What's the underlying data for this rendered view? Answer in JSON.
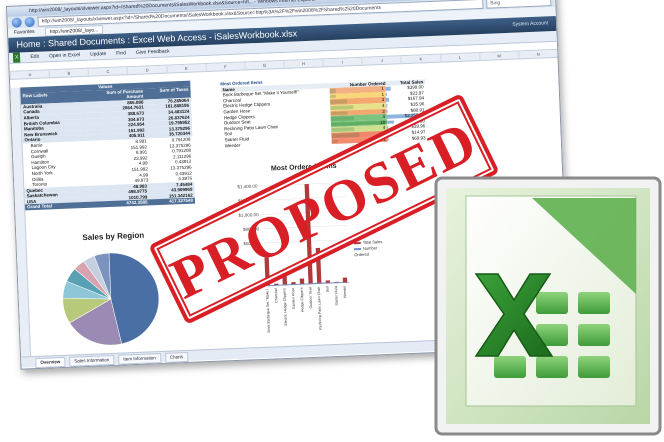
{
  "window": {
    "title": "http://win2008/_layouts/xlviewer.aspx?id=/Shared%20Documents/iSalesWorkbook.xlsx&Source=htt... - Windows Internet Explorer",
    "address": "http://win2008/_layouts/xlviewer.aspx?id=/Shared%20Documents/iSalesWorkbook.xlsx&Source=http%3A%2F%2Fwin2008%2FShared%2520Documents",
    "search_placeholder": "Bing",
    "favorites_label": "Favorites",
    "tab_label": "http://win2008/_layo..."
  },
  "excel": {
    "header_title": "Home : Shared Documents : Excel Web Access - iSalesWorkbook.xlsx",
    "account": "System Account",
    "ribbon": [
      "Edit",
      "Open in Excel",
      "Update",
      "Find",
      "Give Feedback"
    ],
    "columns": [
      "A",
      "B",
      "C",
      "D",
      "E",
      "F",
      "G",
      "H",
      "I",
      "J",
      "K",
      "L",
      "M",
      "N"
    ]
  },
  "pivot": {
    "values_label": "Values",
    "col1": "Row Labels",
    "col2": "Sum of Purchase Amount",
    "col3": "Sum of Taxes",
    "rows": [
      {
        "label": "Australia",
        "a": "866.888",
        "b": "76.285064",
        "style": "b"
      },
      {
        "label": "Canada",
        "a": "2864.7631",
        "b": "181.888186",
        "style": "b"
      },
      {
        "label": "Alberta",
        "a": "388.673",
        "b": "34.483124",
        "style": "b"
      },
      {
        "label": "British Columbia",
        "a": "304.673",
        "b": "26.837624",
        "style": "b"
      },
      {
        "label": "Manitoba",
        "a": "224.954",
        "b": "19.795952",
        "style": "b"
      },
      {
        "label": "New Brunswick",
        "a": "151.992",
        "b": "13.375296",
        "style": "b"
      },
      {
        "label": "Ontario",
        "a": "405.911",
        "b": "35.720344",
        "style": "b"
      },
      {
        "label": "Barrie",
        "a": "8.991",
        "b": "0.791208",
        "style": "sub"
      },
      {
        "label": "Cornwall",
        "a": "151.992",
        "b": "13.375296",
        "style": "sub"
      },
      {
        "label": "Guelph",
        "a": "8.991",
        "b": "0.791208",
        "style": "sub"
      },
      {
        "label": "Hamilton",
        "a": "23.992",
        "b": "2.111296",
        "style": "sub"
      },
      {
        "label": "Lagoon City",
        "a": "4.99",
        "b": "0.43912",
        "style": "sub"
      },
      {
        "label": "North York",
        "a": "151.992",
        "b": "13.375296",
        "style": "sub"
      },
      {
        "label": "Orillia",
        "a": "4.99",
        "b": "0.43912",
        "style": "sub"
      },
      {
        "label": "Toronto",
        "a": "49.973",
        "b": "4.3976",
        "style": "sub"
      },
      {
        "label": "Quebec",
        "a": "48.983",
        "b": "7.45484",
        "style": "b"
      },
      {
        "label": "Saskatchewan",
        "a": "498.9775",
        "b": "43.909969",
        "style": "b"
      },
      {
        "label": "USA",
        "a": "1010.799",
        "b": "151.342162",
        "style": "b"
      }
    ],
    "grand_total": {
      "label": "Grand Total",
      "a": "4742.3585",
      "b": "417.327548"
    }
  },
  "items": {
    "title": "Most Ordered Items",
    "col1": "Name",
    "col2": "Number Ordered",
    "col3": "Total Sales",
    "rows": [
      {
        "name": "Brick Barbeque Set \"Make it Yourself!\"",
        "ordered": "1",
        "sales": "$399.00",
        "color": "#f3b183",
        "pct": 0.1,
        "spct": 0.12
      },
      {
        "name": "Charcoal",
        "ordered": "1",
        "sales": "$23.97",
        "color": "#f7d77a",
        "pct": 0.1,
        "spct": 0.02
      },
      {
        "name": "Electric Hedge Clippers",
        "ordered": "3",
        "sales": "$167.94",
        "color": "#f4a86f",
        "pct": 0.3,
        "spct": 0.06
      },
      {
        "name": "Garden Hose",
        "ordered": "4",
        "sales": "$35.96",
        "color": "#e7e28a",
        "pct": 0.4,
        "spct": 0.02
      },
      {
        "name": "Hedge Clippers",
        "ordered": "3",
        "sales": "$80.91",
        "color": "#f4a86f",
        "pct": 0.3,
        "spct": 0.03
      },
      {
        "name": "Outdoor Seat",
        "ordered": "4",
        "sales": "$3,259.92",
        "color": "#7cc47f",
        "pct": 0.4,
        "spct": 1.0
      },
      {
        "name": "Reclining Patio Lawn Chair",
        "ordered": "10",
        "sales": "$499.90",
        "color": "#6fbf73",
        "pct": 1.0,
        "spct": 0.16
      },
      {
        "name": "Soil",
        "ordered": "4",
        "sales": "$39.96",
        "color": "#cfe090",
        "pct": 0.4,
        "spct": 0.02
      },
      {
        "name": "Starter Fluid",
        "ordered": "5",
        "sales": "$14.97",
        "color": "#f0866b",
        "pct": 0.5,
        "spct": 0.01
      },
      {
        "name": "Weeder",
        "ordered": "1",
        "sales": "$69.93",
        "color": "#f58a6c",
        "pct": 0.1,
        "spct": 0.03
      }
    ]
  },
  "pie_title": "Sales by Region",
  "pie_slices": [
    {
      "value": 0.47,
      "color": "#4a6fa5"
    },
    {
      "value": 0.2,
      "color": "#9b8bb4"
    },
    {
      "value": 0.09,
      "color": "#b7c97a"
    },
    {
      "value": 0.06,
      "color": "#8ec6d8"
    },
    {
      "value": 0.05,
      "color": "#5aa0b5"
    },
    {
      "value": 0.04,
      "color": "#d8a3b0"
    },
    {
      "value": 0.04,
      "color": "#c6cfe0"
    },
    {
      "value": 0.05,
      "color": "#7a93bf"
    }
  ],
  "chart_data": {
    "type": "bar",
    "title": "Most Ordered Items",
    "categories": [
      "Brick Barbeque Set \"Make it Yourself!\"",
      "Charcoal",
      "Electric Hedge Clippers",
      "Garden Hose",
      "Hedge Clippers",
      "Outdoor Seat",
      "Reclining Patio Lawn Chair",
      "Soil",
      "Starter Fluid",
      "Weeder"
    ],
    "series": [
      {
        "name": "Total Sales",
        "values": [
          399.0,
          23.97,
          167.94,
          35.96,
          80.91,
          3259.92,
          499.9,
          39.96,
          14.97,
          69.93
        ],
        "color": "#b03a3a"
      },
      {
        "name": "Number Ordered",
        "values": [
          1,
          1,
          3,
          4,
          3,
          4,
          10,
          4,
          5,
          1
        ],
        "color": "#6b8fc7"
      }
    ],
    "yticks": [
      "$1,400.00",
      "$1,200.00",
      "$1,000.00",
      "$800.00",
      "$600.00"
    ],
    "ylim": [
      0,
      1400
    ]
  },
  "sheet_tabs": [
    "Overview",
    "Sales Information",
    "Item Information",
    "Charts"
  ],
  "stamp_text": "PROPOSED",
  "colors": {
    "stamp": "#d81f26",
    "excel_green": "#2f8b2f",
    "header_blue": "#2f4d73"
  }
}
